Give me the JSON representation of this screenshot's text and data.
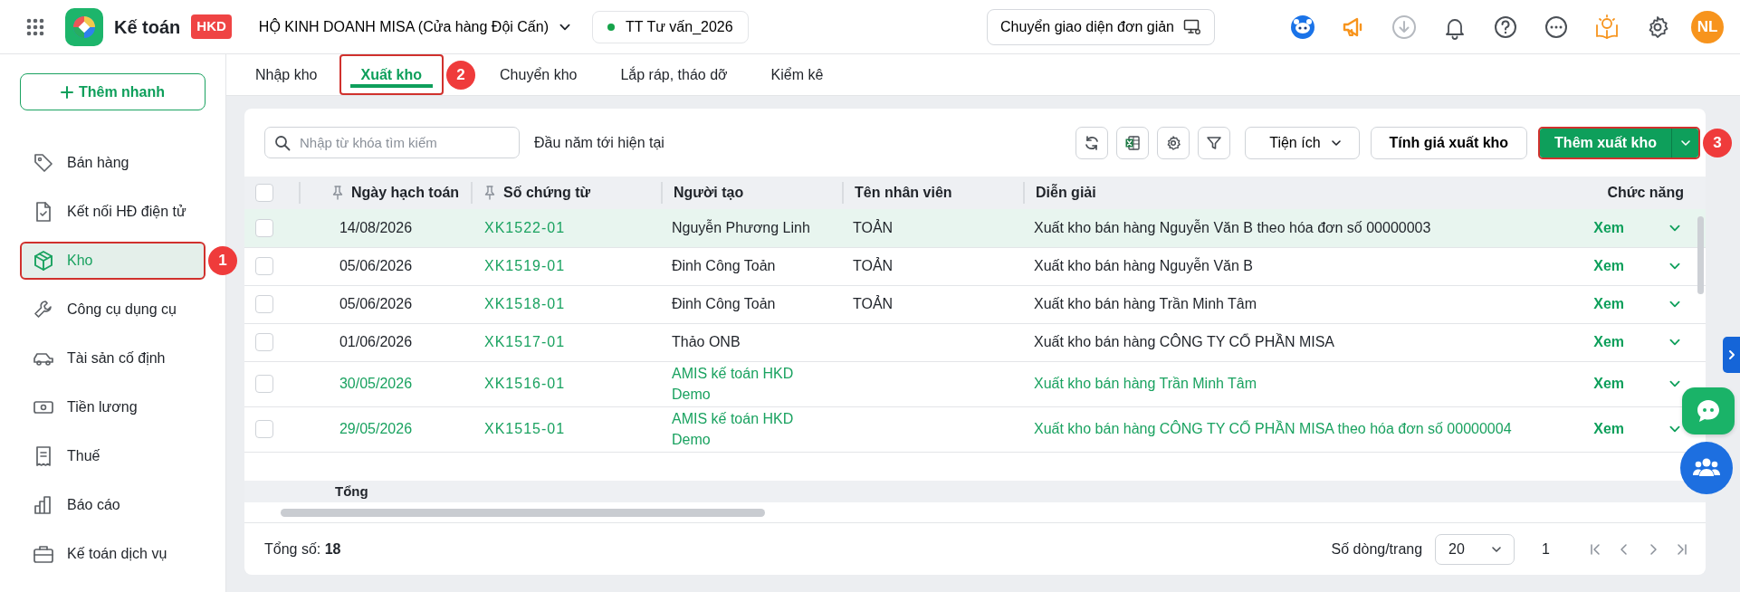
{
  "app": {
    "name": "Kế toán",
    "badge": "HKD",
    "company": "HỘ KINH DOANH MISA (Cửa hàng Đội Cấn)",
    "database": "TT Tư vấn_2026",
    "simple_ui_button": "Chuyển giao diện đơn giản",
    "avatar": "NL"
  },
  "sidebar": {
    "quick_add": "Thêm nhanh",
    "items": [
      {
        "label": "Bán hàng",
        "selected": false
      },
      {
        "label": "Kết nối HĐ điện tử",
        "selected": false
      },
      {
        "label": "Kho",
        "selected": true
      },
      {
        "label": "Công cụ dụng cụ",
        "selected": false
      },
      {
        "label": "Tài sản cố định",
        "selected": false
      },
      {
        "label": "Tiền lương",
        "selected": false
      },
      {
        "label": "Thuế",
        "selected": false
      },
      {
        "label": "Báo cáo",
        "selected": false
      },
      {
        "label": "Kế toán dịch vụ",
        "selected": false
      }
    ]
  },
  "tabs": [
    {
      "label": "Nhập kho",
      "selected": false
    },
    {
      "label": "Xuất kho",
      "selected": true
    },
    {
      "label": "Chuyển kho",
      "selected": false
    },
    {
      "label": "Lắp ráp, tháo dỡ",
      "selected": false
    },
    {
      "label": "Kiểm kê",
      "selected": false
    }
  ],
  "toolbar": {
    "search_placeholder": "Nhập từ khóa tìm kiếm",
    "period": "Đầu năm tới hiện tại",
    "utility_button": "Tiện ích",
    "costing_button": "Tính giá xuất kho",
    "add_button": "Thêm xuất kho"
  },
  "table": {
    "select_all_checked": false,
    "columns": [
      {
        "label": "Ngày hạch toán",
        "pinned": true
      },
      {
        "label": "Số chứng từ",
        "pinned": true
      },
      {
        "label": "Người tạo",
        "pinned": false
      },
      {
        "label": "Tên nhân viên",
        "pinned": false
      },
      {
        "label": "Diễn giải",
        "pinned": false
      },
      {
        "label": "Chức năng",
        "pinned": false
      }
    ],
    "rows": [
      {
        "selected": true,
        "checked": false,
        "system_created": false,
        "date": "14/08/2026",
        "voucher": "XK1522-01",
        "creator": "Nguyễn Phương Linh",
        "employee": "TOẢN",
        "description": "Xuất kho bán hàng Nguyễn Văn B theo hóa đơn số 00000003",
        "action": "Xem"
      },
      {
        "selected": false,
        "checked": false,
        "system_created": false,
        "date": "05/06/2026",
        "voucher": "XK1519-01",
        "creator": "Đinh Công Toản",
        "employee": "TOẢN",
        "description": "Xuất kho bán hàng Nguyễn Văn B",
        "action": "Xem"
      },
      {
        "selected": false,
        "checked": false,
        "system_created": false,
        "date": "05/06/2026",
        "voucher": "XK1518-01",
        "creator": "Đinh Công Toản",
        "employee": "TOẢN",
        "description": "Xuất kho bán hàng Trần Minh Tâm",
        "action": "Xem"
      },
      {
        "selected": false,
        "checked": false,
        "system_created": false,
        "date": "01/06/2026",
        "voucher": "XK1517-01",
        "creator": "Thảo ONB",
        "employee": "",
        "description": "Xuất kho bán hàng CÔNG TY CỔ PHẦN MISA",
        "action": "Xem"
      },
      {
        "selected": false,
        "checked": false,
        "system_created": true,
        "date": "30/05/2026",
        "voucher": "XK1516-01",
        "creator": "AMIS kế toán HKD Demo",
        "employee": "",
        "description": "Xuất kho bán hàng Trần Minh Tâm",
        "action": "Xem"
      },
      {
        "selected": false,
        "checked": false,
        "system_created": true,
        "date": "29/05/2026",
        "voucher": "XK1515-01",
        "creator": "AMIS kế toán HKD Demo",
        "employee": "",
        "description": "Xuất kho bán hàng CÔNG TY CỔ PHẦN MISA theo hóa đơn số 00000004",
        "action": "Xem"
      }
    ],
    "total_label": "Tổng"
  },
  "footer": {
    "total_label": "Tổng số:",
    "total": "18",
    "page_size_label": "Số dòng/trang",
    "page_size": "20",
    "page": "1"
  },
  "callouts": [
    {
      "label": "1"
    },
    {
      "label": "2"
    },
    {
      "label": "3"
    }
  ]
}
